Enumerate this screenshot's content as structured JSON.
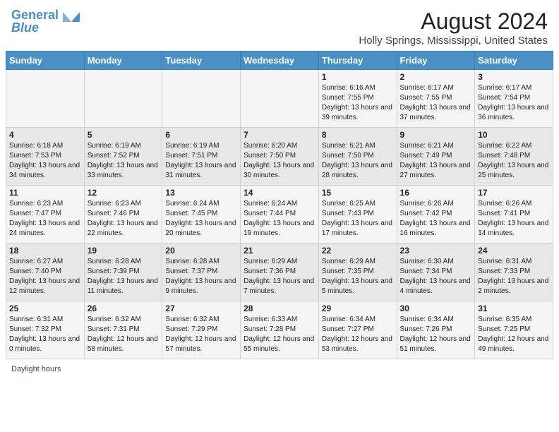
{
  "header": {
    "logo_line1": "General",
    "logo_line2": "Blue",
    "month_year": "August 2024",
    "location": "Holly Springs, Mississippi, United States"
  },
  "days_of_week": [
    "Sunday",
    "Monday",
    "Tuesday",
    "Wednesday",
    "Thursday",
    "Friday",
    "Saturday"
  ],
  "weeks": [
    [
      {
        "day": "",
        "info": ""
      },
      {
        "day": "",
        "info": ""
      },
      {
        "day": "",
        "info": ""
      },
      {
        "day": "",
        "info": ""
      },
      {
        "day": "1",
        "info": "Sunrise: 6:16 AM\nSunset: 7:55 PM\nDaylight: 13 hours and 39 minutes."
      },
      {
        "day": "2",
        "info": "Sunrise: 6:17 AM\nSunset: 7:55 PM\nDaylight: 13 hours and 37 minutes."
      },
      {
        "day": "3",
        "info": "Sunrise: 6:17 AM\nSunset: 7:54 PM\nDaylight: 13 hours and 36 minutes."
      }
    ],
    [
      {
        "day": "4",
        "info": "Sunrise: 6:18 AM\nSunset: 7:53 PM\nDaylight: 13 hours and 34 minutes."
      },
      {
        "day": "5",
        "info": "Sunrise: 6:19 AM\nSunset: 7:52 PM\nDaylight: 13 hours and 33 minutes."
      },
      {
        "day": "6",
        "info": "Sunrise: 6:19 AM\nSunset: 7:51 PM\nDaylight: 13 hours and 31 minutes."
      },
      {
        "day": "7",
        "info": "Sunrise: 6:20 AM\nSunset: 7:50 PM\nDaylight: 13 hours and 30 minutes."
      },
      {
        "day": "8",
        "info": "Sunrise: 6:21 AM\nSunset: 7:50 PM\nDaylight: 13 hours and 28 minutes."
      },
      {
        "day": "9",
        "info": "Sunrise: 6:21 AM\nSunset: 7:49 PM\nDaylight: 13 hours and 27 minutes."
      },
      {
        "day": "10",
        "info": "Sunrise: 6:22 AM\nSunset: 7:48 PM\nDaylight: 13 hours and 25 minutes."
      }
    ],
    [
      {
        "day": "11",
        "info": "Sunrise: 6:23 AM\nSunset: 7:47 PM\nDaylight: 13 hours and 24 minutes."
      },
      {
        "day": "12",
        "info": "Sunrise: 6:23 AM\nSunset: 7:46 PM\nDaylight: 13 hours and 22 minutes."
      },
      {
        "day": "13",
        "info": "Sunrise: 6:24 AM\nSunset: 7:45 PM\nDaylight: 13 hours and 20 minutes."
      },
      {
        "day": "14",
        "info": "Sunrise: 6:24 AM\nSunset: 7:44 PM\nDaylight: 13 hours and 19 minutes."
      },
      {
        "day": "15",
        "info": "Sunrise: 6:25 AM\nSunset: 7:43 PM\nDaylight: 13 hours and 17 minutes."
      },
      {
        "day": "16",
        "info": "Sunrise: 6:26 AM\nSunset: 7:42 PM\nDaylight: 13 hours and 16 minutes."
      },
      {
        "day": "17",
        "info": "Sunrise: 6:26 AM\nSunset: 7:41 PM\nDaylight: 13 hours and 14 minutes."
      }
    ],
    [
      {
        "day": "18",
        "info": "Sunrise: 6:27 AM\nSunset: 7:40 PM\nDaylight: 13 hours and 12 minutes."
      },
      {
        "day": "19",
        "info": "Sunrise: 6:28 AM\nSunset: 7:39 PM\nDaylight: 13 hours and 11 minutes."
      },
      {
        "day": "20",
        "info": "Sunrise: 6:28 AM\nSunset: 7:37 PM\nDaylight: 13 hours and 9 minutes."
      },
      {
        "day": "21",
        "info": "Sunrise: 6:29 AM\nSunset: 7:36 PM\nDaylight: 13 hours and 7 minutes."
      },
      {
        "day": "22",
        "info": "Sunrise: 6:29 AM\nSunset: 7:35 PM\nDaylight: 13 hours and 5 minutes."
      },
      {
        "day": "23",
        "info": "Sunrise: 6:30 AM\nSunset: 7:34 PM\nDaylight: 13 hours and 4 minutes."
      },
      {
        "day": "24",
        "info": "Sunrise: 6:31 AM\nSunset: 7:33 PM\nDaylight: 13 hours and 2 minutes."
      }
    ],
    [
      {
        "day": "25",
        "info": "Sunrise: 6:31 AM\nSunset: 7:32 PM\nDaylight: 13 hours and 0 minutes."
      },
      {
        "day": "26",
        "info": "Sunrise: 6:32 AM\nSunset: 7:31 PM\nDaylight: 12 hours and 58 minutes."
      },
      {
        "day": "27",
        "info": "Sunrise: 6:32 AM\nSunset: 7:29 PM\nDaylight: 12 hours and 57 minutes."
      },
      {
        "day": "28",
        "info": "Sunrise: 6:33 AM\nSunset: 7:28 PM\nDaylight: 12 hours and 55 minutes."
      },
      {
        "day": "29",
        "info": "Sunrise: 6:34 AM\nSunset: 7:27 PM\nDaylight: 12 hours and 53 minutes."
      },
      {
        "day": "30",
        "info": "Sunrise: 6:34 AM\nSunset: 7:26 PM\nDaylight: 12 hours and 51 minutes."
      },
      {
        "day": "31",
        "info": "Sunrise: 6:35 AM\nSunset: 7:25 PM\nDaylight: 12 hours and 49 minutes."
      }
    ]
  ],
  "footer": {
    "daylight_label": "Daylight hours"
  }
}
